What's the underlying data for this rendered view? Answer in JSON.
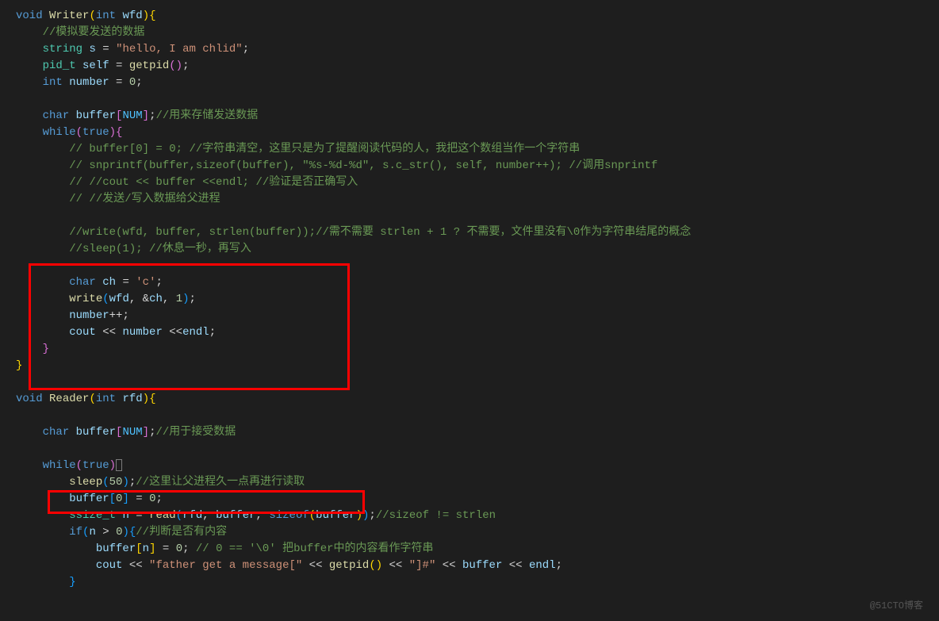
{
  "watermark": "@51CTO博客",
  "code": {
    "l1_void": "void",
    "l1_fn": "Writer",
    "l1_int": "int",
    "l1_param": "wfd",
    "l2_comment": "//模拟要发送的数据",
    "l3_type": "string",
    "l3_var": "s",
    "l3_eq": " = ",
    "l3_str": "\"hello, I am chlid\"",
    "l4_type": "pid_t",
    "l4_var": "self",
    "l4_fn": "getpid",
    "l5_int": "int",
    "l5_var": "number",
    "l5_val": "0",
    "l6_char": "char",
    "l6_var": "buffer",
    "l6_const": "NUM",
    "l6_comment": "//用来存储发送数据",
    "l7_while": "while",
    "l7_true": "true",
    "l8_comment": "// buffer[0] = 0; //字符串清空，这里只是为了提醒阅读代码的人，我把这个数组当作一个字符串",
    "l9_comment": "// snprintf(buffer,sizeof(buffer), \"%s-%d-%d\", s.c_str(), self, number++); //调用snprintf",
    "l10_comment": "// //cout << buffer <<endl; //验证是否正确写入",
    "l11_comment": "// //发送/写入数据给父进程",
    "l12_comment": "//write(wfd, buffer, strlen(buffer));//需不需要 strlen + 1 ? 不需要，文件里没有\\0作为字符串结尾的概念",
    "l13_comment": "//sleep(1); //休息一秒，再写入",
    "l14_char": "char",
    "l14_var": "ch",
    "l14_val": "'c'",
    "l15_fn": "write",
    "l15_a1": "wfd",
    "l15_a2": "ch",
    "l15_a3": "1",
    "l16": "number",
    "l17_cout": "cout",
    "l17_var": "number",
    "l17_endl": "endl",
    "r1_void": "void",
    "r1_fn": "Reader",
    "r1_int": "int",
    "r1_param": "rfd",
    "r2_char": "char",
    "r2_var": "buffer",
    "r2_const": "NUM",
    "r2_comment": "//用于接受数据",
    "r3_while": "while",
    "r3_true": "true",
    "r4_fn": "sleep",
    "r4_val": "50",
    "r4_comment": "//这里让父进程久一点再进行读取",
    "r5_var": "buffer",
    "r5_idx": "0",
    "r5_val": "0",
    "r6_type": "ssize_t",
    "r6_var": "n",
    "r6_fn": "read",
    "r6_a1": "rfd",
    "r6_a2": "buffer",
    "r6_sizeof": "sizeof",
    "r6_a3": "buffer",
    "r6_comment": "//sizeof != strlen",
    "r7_if": "if",
    "r7_var": "n",
    "r7_val": "0",
    "r7_comment": "//判断是否有内容",
    "r8_var": "buffer",
    "r8_n": "n",
    "r8_val": "0",
    "r8_comment": "// 0 == '\\0' 把buffer中的内容看作字符串",
    "r9_cout": "cout",
    "r9_str1": "\"father get a message[\"",
    "r9_fn": "getpid",
    "r9_str2": "\"]#\"",
    "r9_var": "buffer",
    "r9_endl": "endl"
  }
}
